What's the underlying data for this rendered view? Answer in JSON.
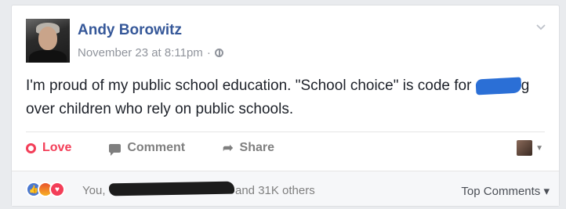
{
  "post": {
    "author": "Andy Borowitz",
    "timestamp": "November 23 at 8:11pm",
    "separator": "·",
    "text_before": "I'm proud of my public school education. \"School choice\" is code for ",
    "text_after": "g over children who rely on public schools."
  },
  "actions": {
    "love": "Love",
    "comment": "Comment",
    "share": "Share"
  },
  "reactions": {
    "you": "You,",
    "others": "and 31K others",
    "top_comments": "Top Comments ▾"
  },
  "icons": {
    "privacy": "globe-icon",
    "options": "chevron-down-icon",
    "love": "heart-outline-icon",
    "comment": "comment-icon",
    "share": "share-arrow-icon",
    "reaction_like": "like-reaction-icon",
    "reaction_angry": "angry-reaction-icon",
    "reaction_love": "love-reaction-icon"
  },
  "colors": {
    "author": "#365899",
    "love": "#f33e58",
    "muted": "#90949c",
    "redaction_blue": "#2b6fd6"
  }
}
